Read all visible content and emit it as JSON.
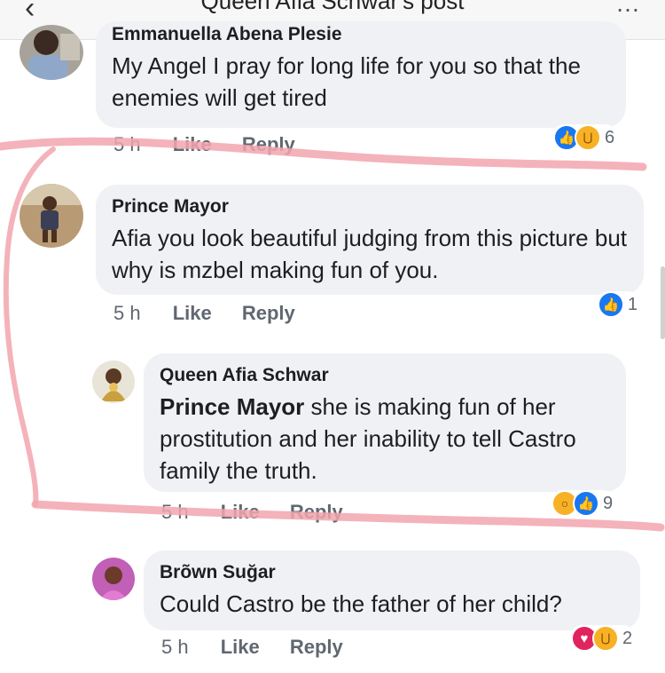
{
  "header": {
    "title": "Queen Afia Schwar's post",
    "back_icon": "back-arrow-icon",
    "more_icon": "more-dots-icon"
  },
  "comments": [
    {
      "author": "Emmanuella Abena Plesie",
      "text": "My Angel I pray for long life for you so that the enemies will get tired",
      "time": "5 h",
      "like": "Like",
      "reply": "Reply",
      "reactions": [
        "like-icon",
        "haha-icon"
      ],
      "reaction_count": "6"
    },
    {
      "author": "Prince Mayor",
      "text": "Afia you look beautiful judging from this picture but why is mzbel making fun of you.",
      "time": "5 h",
      "like": "Like",
      "reply": "Reply",
      "reactions": [
        "like-icon"
      ],
      "reaction_count": "1"
    },
    {
      "author": "Queen Afia Schwar",
      "mention": "Prince Mayor",
      "text": "she is making fun of her prostitution and her inability to tell Castro family the truth.",
      "time": "5 h",
      "like": "Like",
      "reply": "Reply",
      "reactions": [
        "wow-icon",
        "like-icon"
      ],
      "reaction_count": "9"
    },
    {
      "author": "Brõwn Suğar",
      "text": "Could Castro be the father of her child?",
      "time": "5 h",
      "like": "Like",
      "reply": "Reply",
      "reactions": [
        "love-icon",
        "haha-icon"
      ],
      "reaction_count": "2"
    }
  ],
  "colors": {
    "bubble": "#f0f1f4",
    "meta_text": "#606770",
    "like_blue": "#1877f2",
    "emoji_yellow": "#f7b125",
    "love_red": "#e0245e",
    "pen_highlight": "#f2a4ae"
  }
}
